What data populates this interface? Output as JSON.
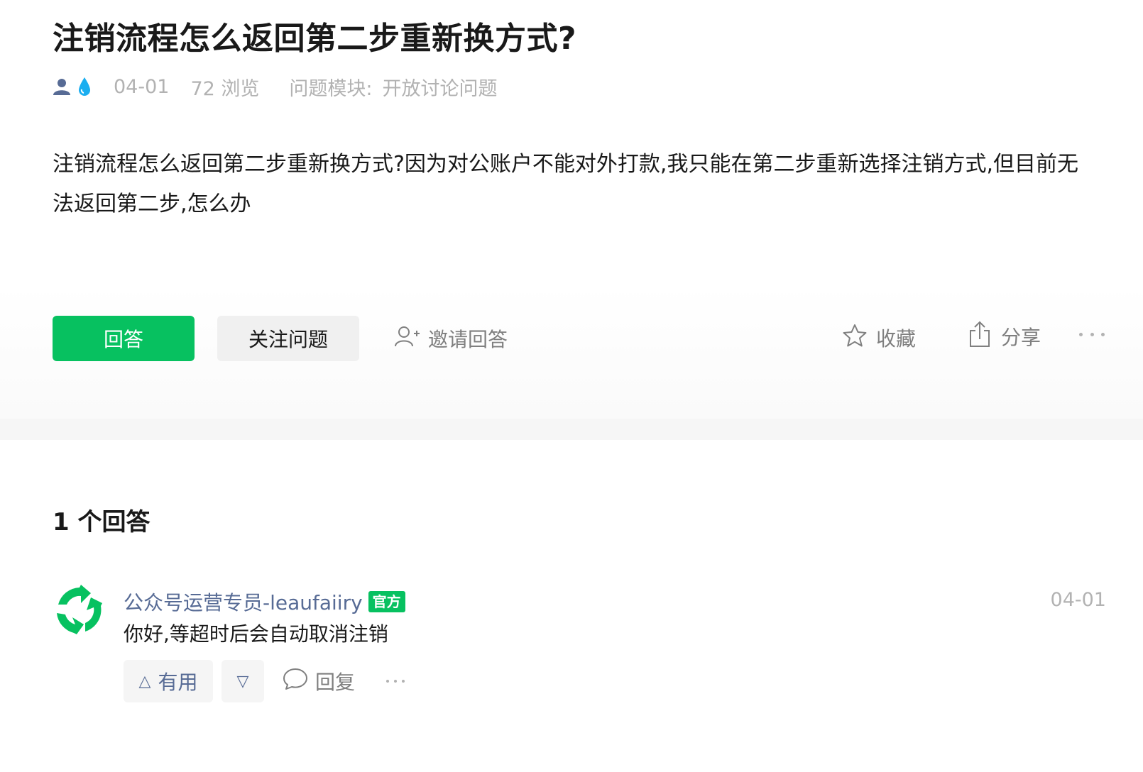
{
  "question": {
    "title": "注销流程怎么返回第二步重新换方式?",
    "meta": {
      "date": "04-01",
      "views": "72 浏览",
      "module_label": "问题模块:",
      "module_value": "开放讨论问题"
    },
    "body": "注销流程怎么返回第二步重新换方式?因为对公账户不能对外打款,我只能在第二步重新选择注销方式,但目前无法返回第二步,怎么办"
  },
  "actions": {
    "answer_label": "回答",
    "follow_label": "关注问题",
    "invite_label": "邀请回答",
    "favorite_label": "收藏",
    "share_label": "分享"
  },
  "answers": {
    "heading": "1 个回答",
    "items": [
      {
        "author": "公众号运营专员-leaufaiiry",
        "badge": "官方",
        "date": "04-01",
        "text": "你好,等超时后会自动取消注销",
        "useful_label": "有用",
        "useful_icon": "△",
        "down_icon": "▽",
        "reply_label": "回复"
      }
    ]
  },
  "colors": {
    "brand_green": "#07c160",
    "link_blue": "#576b95",
    "muted_gray": "#b2b2b2",
    "drop_blue": "#1aaef0"
  },
  "icons": [
    "user-icon",
    "water-drop-icon",
    "invite-user-icon",
    "star-icon",
    "share-icon",
    "more-icon",
    "avatar-logo-icon",
    "comment-bubble-icon"
  ]
}
